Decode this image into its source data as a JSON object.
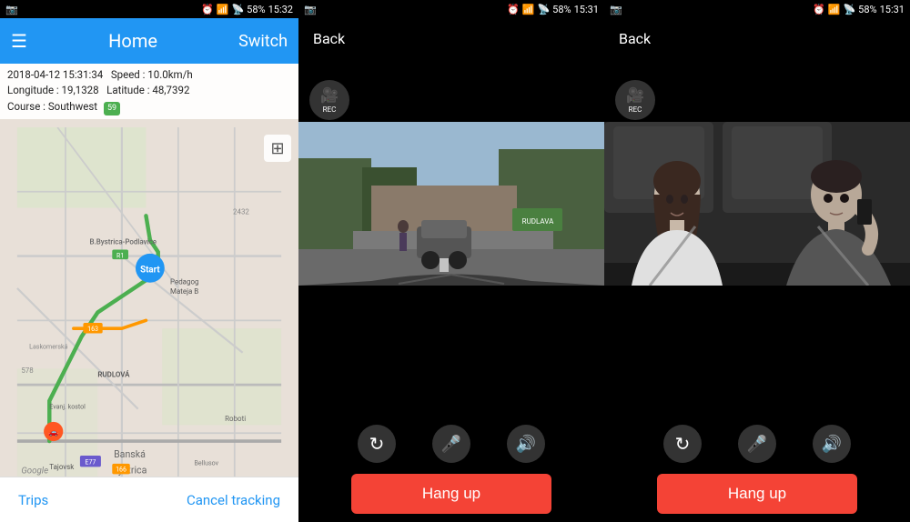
{
  "panel_map": {
    "status_bar": {
      "left": "📷",
      "time": "15:32",
      "battery": "58%"
    },
    "header": {
      "title": "Home",
      "switch_label": "Switch",
      "menu_icon": "☰"
    },
    "info": {
      "datetime": "2018-04-12  15:31:34",
      "speed_label": "Speed :",
      "speed_value": "10.0km/h",
      "longitude_label": "Longitude :",
      "longitude_value": "19,1328",
      "latitude_label": "Latitude :",
      "latitude_value": "48,7392",
      "course_label": "Course :",
      "course_value": "Southwest",
      "course_badge": "59"
    },
    "bottom": {
      "trips_label": "Trips",
      "cancel_label": "Cancel tracking"
    }
  },
  "panel_cam1": {
    "status_bar": {
      "time": "15:31",
      "battery": "58%"
    },
    "back_label": "Back",
    "rec_label": "REC",
    "hang_up_label": "Hang up"
  },
  "panel_cam2": {
    "status_bar": {
      "time": "15:31",
      "battery": "58%"
    },
    "back_label": "Back",
    "rec_label": "REC",
    "hang_up_label": "Hang up"
  },
  "icons": {
    "refresh": "↻",
    "mic_off": "🎤",
    "speaker": "🔊",
    "camera": "📷"
  },
  "colors": {
    "blue": "#2196F3",
    "green": "#4CAF50",
    "red": "#F44336",
    "dark": "#111",
    "rec_icon": "#fff"
  }
}
